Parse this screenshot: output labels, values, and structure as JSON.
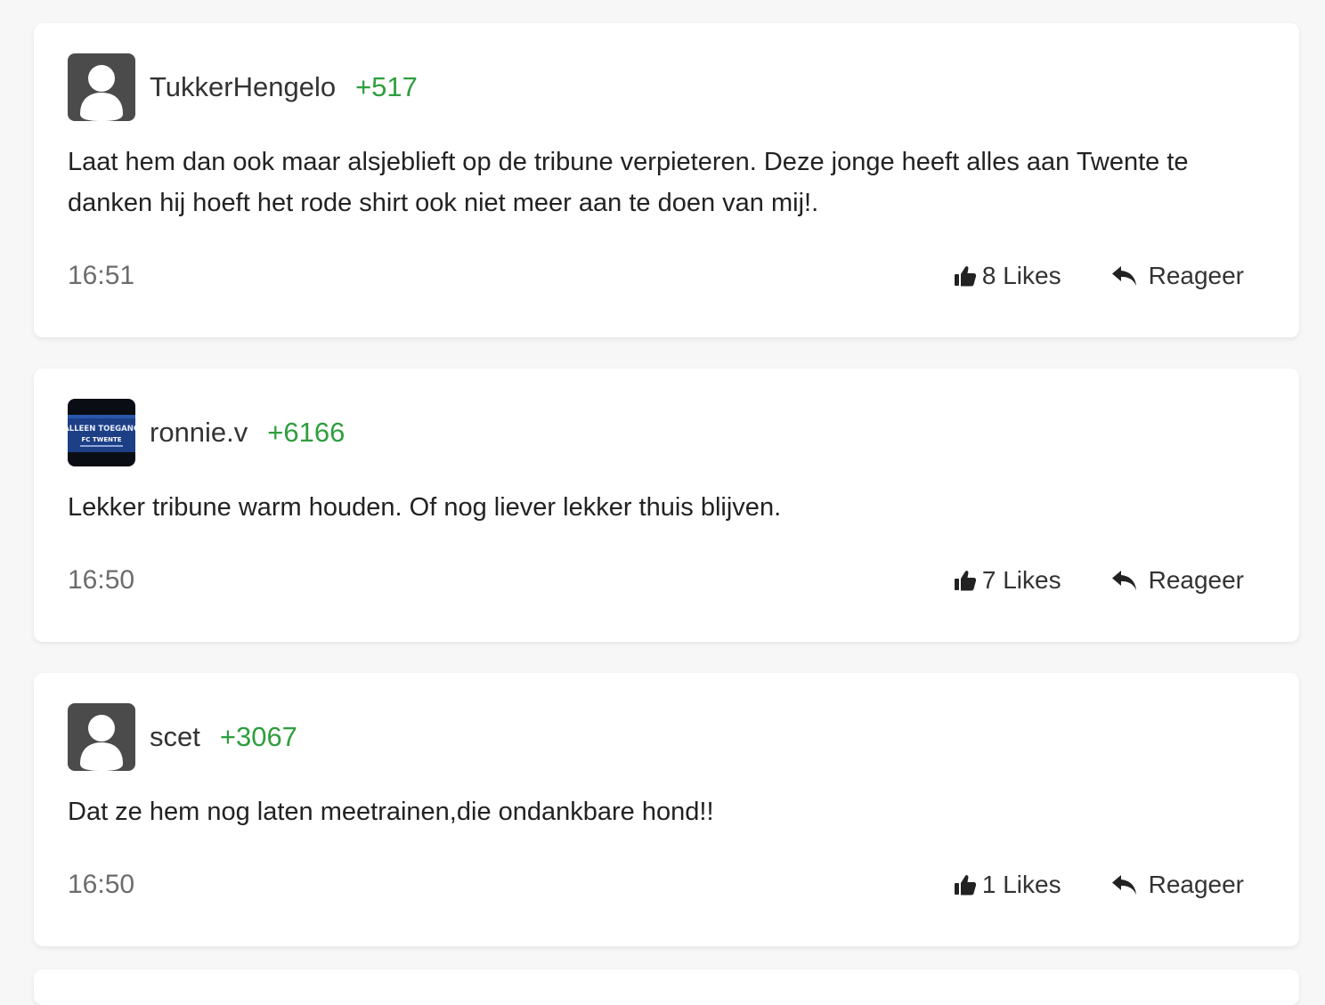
{
  "colors": {
    "karma": "#2e9e3e",
    "avatar_bg": "#4b4b4b"
  },
  "comments": [
    {
      "username": "TukkerHengelo",
      "karma": "+517",
      "avatar": "default-avatar-icon",
      "text": "Laat hem dan ook maar alsjeblieft op de tribune verpieteren. Deze jonge heeft alles aan Twente te danken hij hoeft het rode shirt ook niet meer aan te doen van mij!.",
      "time": "16:51",
      "likes": "8 Likes",
      "reply": "Reageer"
    },
    {
      "username": "ronnie.v",
      "karma": "+6166",
      "avatar": "user-photo",
      "avatar_text_1": "ALLEEN TOEGANG",
      "avatar_text_2": "FC TWENTE",
      "text": "Lekker tribune warm houden. Of nog liever lekker thuis blijven.",
      "time": "16:50",
      "likes": "7 Likes",
      "reply": "Reageer"
    },
    {
      "username": "scet",
      "karma": "+3067",
      "avatar": "default-avatar-icon",
      "text": "Dat ze hem nog laten meetrainen,die ondankbare hond!!",
      "time": "16:50",
      "likes": "1 Likes",
      "reply": "Reageer"
    }
  ]
}
